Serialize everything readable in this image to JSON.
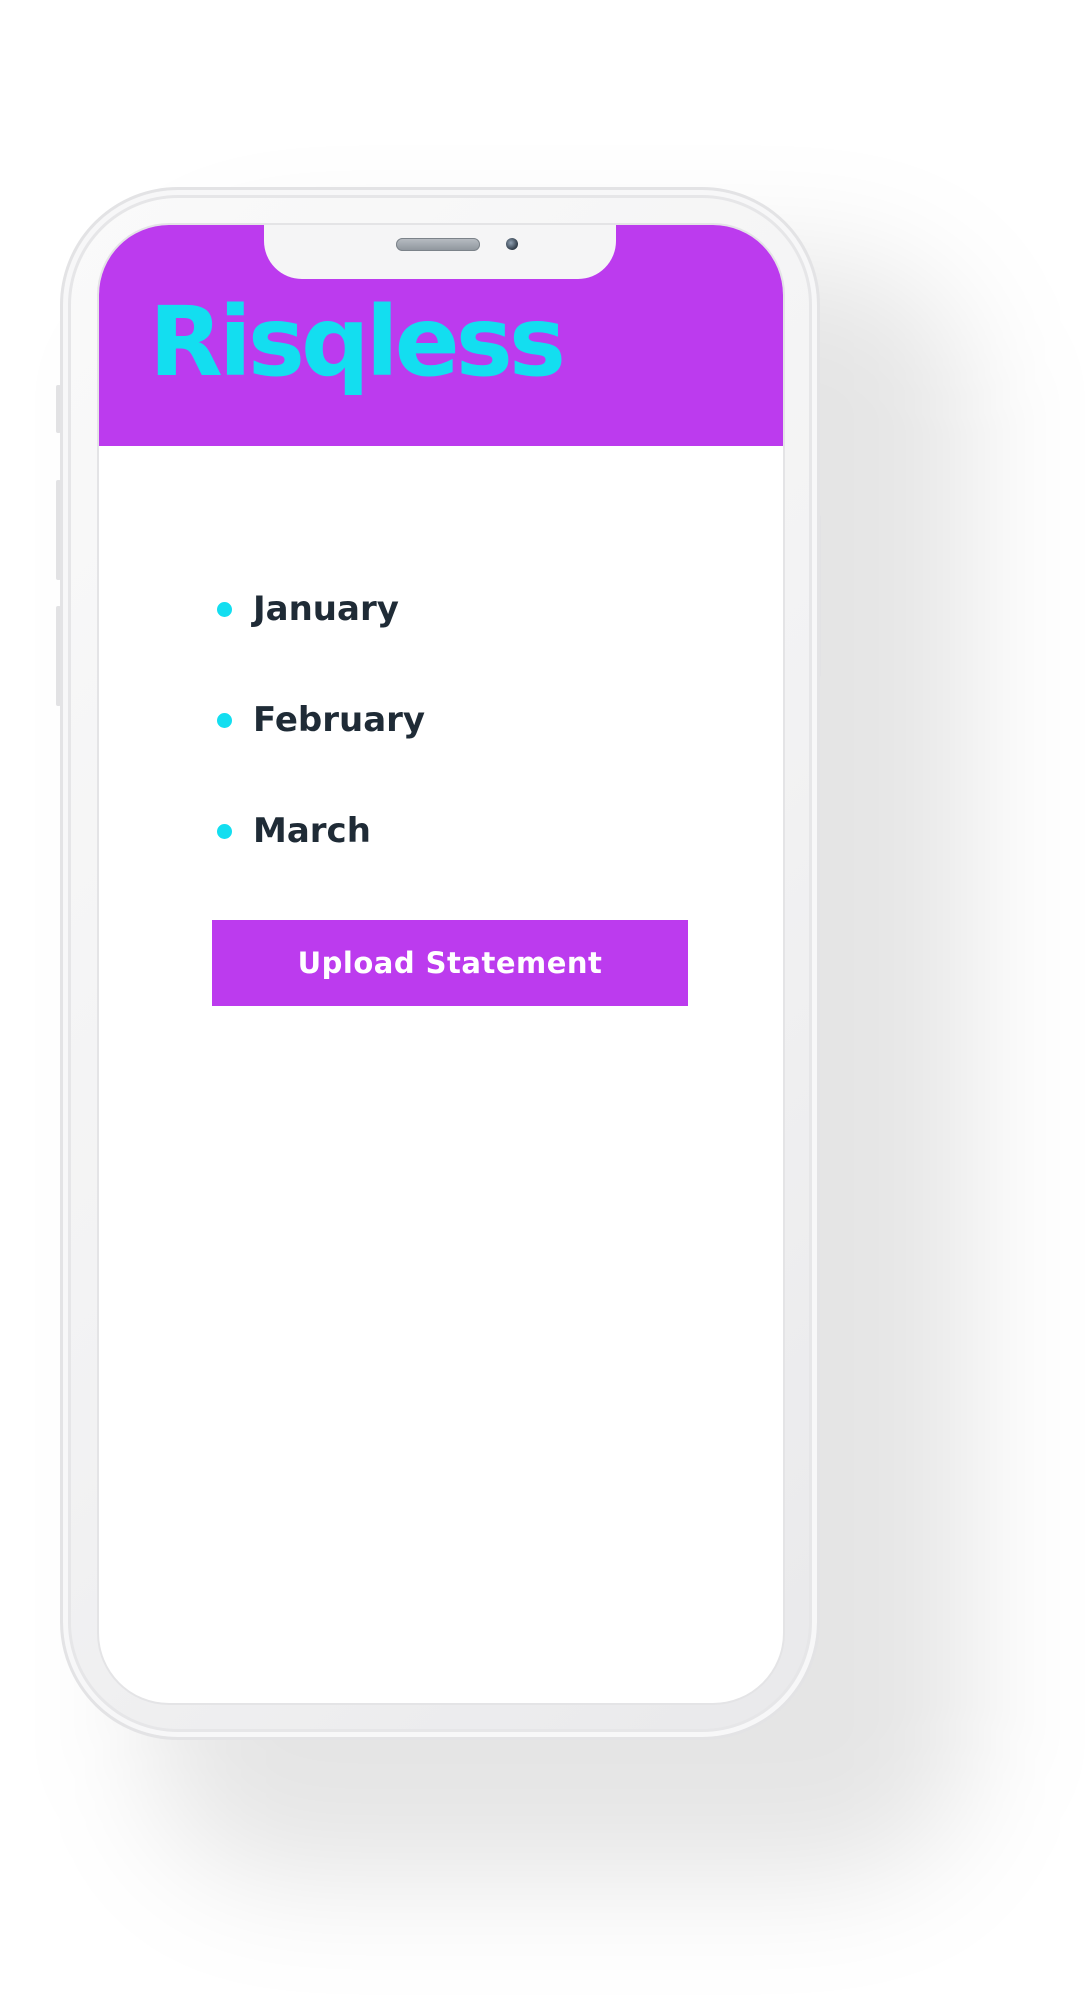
{
  "app": {
    "logo_text": "Risqless",
    "brand_color": "#bc3bee",
    "accent_color": "#13def0"
  },
  "months": {
    "items": [
      {
        "label": "January"
      },
      {
        "label": "February"
      },
      {
        "label": "March"
      }
    ],
    "bullet_icon": "dot-icon"
  },
  "actions": {
    "upload_label": "Upload Statement"
  },
  "device": {
    "model_icon": "smartphone-frame",
    "speaker_icon": "speaker-grille-icon",
    "camera_icon": "front-camera-icon"
  }
}
